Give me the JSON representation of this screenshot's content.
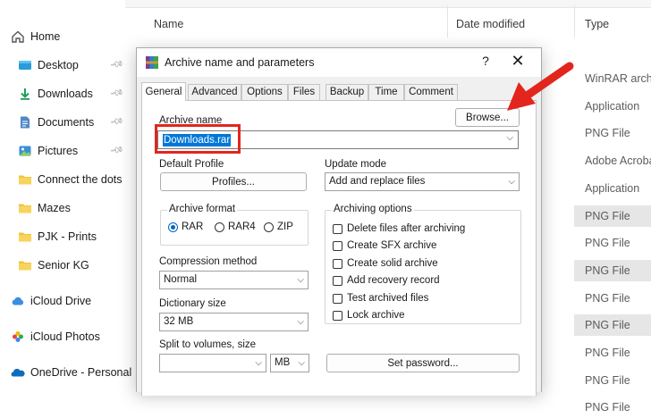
{
  "explorer": {
    "nav": [
      {
        "label": "Home",
        "icon": "home-icon"
      },
      {
        "label": "Desktop",
        "icon": "desktop-folder-icon",
        "pinned": true
      },
      {
        "label": "Downloads",
        "icon": "download-icon",
        "pinned": true
      },
      {
        "label": "Documents",
        "icon": "documents-icon",
        "pinned": true
      },
      {
        "label": "Pictures",
        "icon": "pictures-icon",
        "pinned": true
      },
      {
        "label": "Connect the dots",
        "icon": "folder-icon"
      },
      {
        "label": "Mazes",
        "icon": "folder-icon"
      },
      {
        "label": "PJK - Prints",
        "icon": "folder-icon"
      },
      {
        "label": "Senior KG",
        "icon": "folder-icon"
      },
      {
        "label": "iCloud Drive",
        "icon": "icloud-icon"
      },
      {
        "label": "iCloud Photos",
        "icon": "icloud-photos-icon"
      },
      {
        "label": "OneDrive - Personal",
        "icon": "onedrive-icon"
      }
    ],
    "columns": {
      "name": "Name",
      "date_modified": "Date modified",
      "type": "Type"
    },
    "type_rows": [
      "WinRAR archi",
      "Application",
      "PNG File",
      "Adobe Acroba",
      "Application",
      "PNG File",
      "PNG File",
      "PNG File",
      "PNG File",
      "PNG File",
      "PNG File",
      "PNG File",
      "PNG File"
    ]
  },
  "dialog": {
    "title": "Archive name and parameters",
    "help": "?",
    "close": "✕",
    "tabs": [
      "General",
      "Advanced",
      "Options",
      "Files",
      "Backup",
      "Time",
      "Comment"
    ],
    "archive_name_label": "Archive name",
    "browse_button": "Browse...",
    "archive_name_value": "Downloads.rar",
    "default_profile_label": "Default Profile",
    "profiles_button": "Profiles...",
    "update_mode_label": "Update mode",
    "update_mode_value": "Add and replace files",
    "archive_format_label": "Archive format",
    "formats": [
      {
        "label": "RAR",
        "selected": true
      },
      {
        "label": "RAR4",
        "selected": false
      },
      {
        "label": "ZIP",
        "selected": false
      }
    ],
    "archiving_options_label": "Archiving options",
    "options": [
      {
        "label": "Delete files after archiving",
        "checked": false
      },
      {
        "label": "Create SFX archive",
        "checked": false
      },
      {
        "label": "Create solid archive",
        "checked": false
      },
      {
        "label": "Add recovery record",
        "checked": false
      },
      {
        "label": "Test archived files",
        "checked": false
      },
      {
        "label": "Lock archive",
        "checked": false
      }
    ],
    "compression_method_label": "Compression method",
    "compression_method_value": "Normal",
    "dictionary_size_label": "Dictionary size",
    "dictionary_size_value": "32 MB",
    "split_label": "Split to volumes, size",
    "split_value": "",
    "split_unit": "MB",
    "set_password_button": "Set password..."
  },
  "colors": {
    "accent": "#0078d7",
    "highlight": "#e2261d",
    "selection_row": "#e6e6e6"
  }
}
